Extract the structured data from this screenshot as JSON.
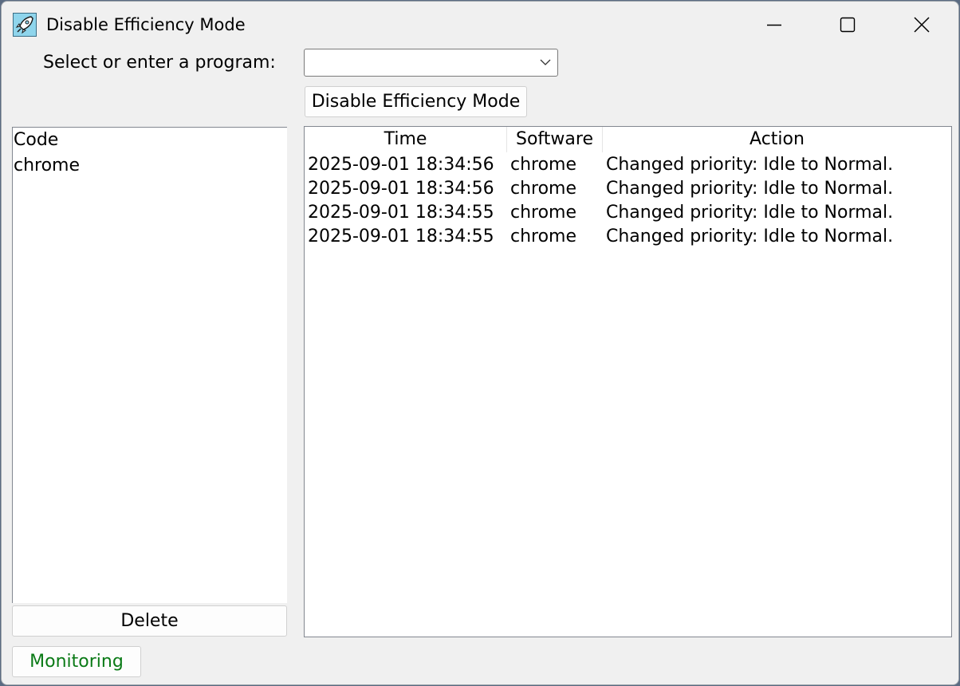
{
  "window": {
    "title": "Disable Efficiency Mode",
    "app_icon": "rocket-icon",
    "controls": [
      "minimize-icon",
      "maximize-icon",
      "close-icon"
    ]
  },
  "program_select": {
    "label": "Select or enter a program:",
    "value": ""
  },
  "disable_button": {
    "label": "Disable Efficiency Mode"
  },
  "program_list": {
    "items": [
      "Code",
      "chrome"
    ]
  },
  "delete_button": {
    "label": "Delete"
  },
  "status_button": {
    "label": "Monitoring",
    "color": "#0a7a16"
  },
  "log_table": {
    "columns": [
      "Time",
      "Software",
      "Action"
    ],
    "rows": [
      {
        "time": "2025-09-01 18:34:56",
        "software": "chrome",
        "action": "Changed priority: Idle to Normal."
      },
      {
        "time": "2025-09-01 18:34:56",
        "software": "chrome",
        "action": "Changed priority: Idle to Normal."
      },
      {
        "time": "2025-09-01 18:34:55",
        "software": "chrome",
        "action": "Changed priority: Idle to Normal."
      },
      {
        "time": "2025-09-01 18:34:55",
        "software": "chrome",
        "action": "Changed priority: Idle to Normal."
      }
    ]
  }
}
